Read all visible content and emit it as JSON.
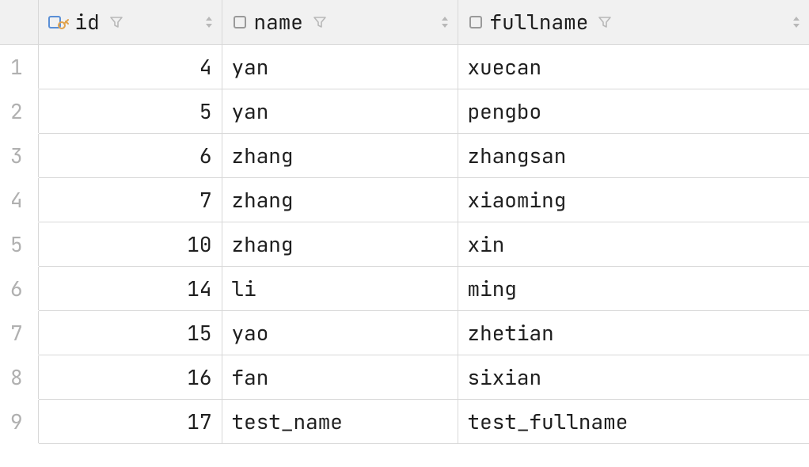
{
  "columns": [
    {
      "key": "id",
      "label": "id",
      "icon": "key",
      "align": "num"
    },
    {
      "key": "name",
      "label": "name",
      "icon": "column",
      "align": "txt"
    },
    {
      "key": "fullname",
      "label": "fullname",
      "icon": "column",
      "align": "txt"
    }
  ],
  "rows": [
    {
      "n": "1",
      "id": "4",
      "name": "yan",
      "fullname": "xuecan"
    },
    {
      "n": "2",
      "id": "5",
      "name": "yan",
      "fullname": "pengbo"
    },
    {
      "n": "3",
      "id": "6",
      "name": "zhang",
      "fullname": "zhangsan"
    },
    {
      "n": "4",
      "id": "7",
      "name": "zhang",
      "fullname": "xiaoming"
    },
    {
      "n": "5",
      "id": "10",
      "name": "zhang",
      "fullname": "xin"
    },
    {
      "n": "6",
      "id": "14",
      "name": "li",
      "fullname": "ming"
    },
    {
      "n": "7",
      "id": "15",
      "name": "yao",
      "fullname": "zhetian"
    },
    {
      "n": "8",
      "id": "16",
      "name": "fan",
      "fullname": "sixian"
    },
    {
      "n": "9",
      "id": "17",
      "name": "test_name",
      "fullname": "test_fullname"
    }
  ]
}
